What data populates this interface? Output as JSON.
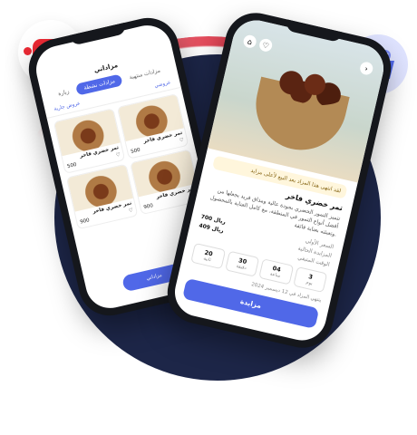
{
  "left_phone": {
    "title": "مزاداتي",
    "tabs": [
      "زيارة",
      "مزادات نشطة",
      "مزادات منتهية"
    ],
    "subtabs": [
      "عروض جارية",
      "عروضي"
    ],
    "cards": [
      {
        "title": "تمر خضري فاخر",
        "price": "500"
      },
      {
        "title": "تمر خضري فاخر",
        "price": "500"
      },
      {
        "title": "تمر خضري فاخر",
        "price": "900"
      },
      {
        "title": "تمر خضري فاخر",
        "price": "900"
      }
    ],
    "nav_label": "مزاداتي"
  },
  "right_phone": {
    "alert": "لقد انتهى هذا المزاد بعد البيع لأعلى مزايد",
    "title": "تمر خضري فاخر",
    "description": "تتميز التمور الخضري بجودة عالية ومذاق فريد يجعلها من أفضل أنواع التمور في المنطقة، مع كامل العناية بالمحصول وتعبئته بعناية فائقة.",
    "fields": [
      {
        "k": "السعر الأولي",
        "v": "700 ريال"
      },
      {
        "k": "المزايدة الحالية",
        "v": "409 ريال"
      }
    ],
    "countdown_label": "الوقت المتبقي",
    "counts": [
      {
        "n": "20",
        "u": "ثانية"
      },
      {
        "n": "30",
        "u": "دقيقة"
      },
      {
        "n": "04",
        "u": "ساعة"
      },
      {
        "n": "3",
        "u": "يوم"
      }
    ],
    "date": "ينتهي المزاد في 12 ديسمبر 2024",
    "button": "مزايدة"
  },
  "colors": {
    "accent": "#5068e8",
    "navy": "#1d2648",
    "red": "#ec2a35"
  }
}
